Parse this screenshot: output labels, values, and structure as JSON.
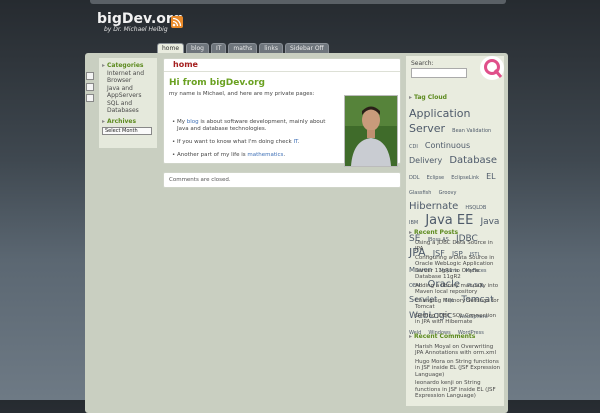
{
  "site": {
    "title": "bigDev.org",
    "subtitle": "by Dr. Michael Helbig"
  },
  "nav": {
    "tabs": [
      "home",
      "blog",
      "IT",
      "maths",
      "links",
      "Sidebar Off"
    ],
    "active_index": 0
  },
  "sidebar_left": {
    "categories_title": "Categories",
    "categories": [
      "Internet and Browser",
      "Java and AppServers",
      "SQL and Databases"
    ],
    "archives_title": "Archives",
    "archives_select": "Select Month"
  },
  "main": {
    "page_title": "home",
    "post_title": "Hi from bigDev.org",
    "intro": "my name is Michael, and here are my private pages:",
    "bullet1_pre": "My ",
    "bullet1_link": "blog",
    "bullet1_post": " is about software development, mainly about Java and database technologies.",
    "bullet2_pre": "If you want to know what I'm doing check ",
    "bullet2_link": "IT",
    "bullet2_post": ".",
    "bullet3_pre": "Another part of my life is ",
    "bullet3_link": "mathematics",
    "bullet3_post": ".",
    "comments": "Comments are closed."
  },
  "sidebar_right": {
    "search_label": "Search:",
    "tag_cloud_title": "Tag Cloud",
    "tags": [
      {
        "t": "Application Server",
        "s": 11
      },
      {
        "t": "Bean Validation",
        "s": 5
      },
      {
        "t": "CDI",
        "s": 5
      },
      {
        "t": "Continuous Delivery",
        "s": 8
      },
      {
        "t": "Database",
        "s": 10
      },
      {
        "t": "DDL",
        "s": 5
      },
      {
        "t": "Eclipse",
        "s": 5
      },
      {
        "t": "EclipseLink",
        "s": 5
      },
      {
        "t": "EL",
        "s": 8
      },
      {
        "t": "Glassfish",
        "s": 5
      },
      {
        "t": "Groovy",
        "s": 5
      },
      {
        "t": "Hibernate",
        "s": 10
      },
      {
        "t": "HSQLDB",
        "s": 5
      },
      {
        "t": "IBM",
        "s": 5
      },
      {
        "t": "Java EE",
        "s": 13
      },
      {
        "t": "Java SE",
        "s": 9
      },
      {
        "t": "JBoss AS",
        "s": 5
      },
      {
        "t": "JDBC",
        "s": 9
      },
      {
        "t": "JPA",
        "s": 11
      },
      {
        "t": "JSF",
        "s": 8
      },
      {
        "t": "JSP",
        "s": 7
      },
      {
        "t": "JSTL",
        "s": 5
      },
      {
        "t": "Maven",
        "s": 7
      },
      {
        "t": "Mojarra",
        "s": 5
      },
      {
        "t": "MyFaces",
        "s": 5
      },
      {
        "t": "OEM",
        "s": 5
      },
      {
        "t": "Oracle",
        "s": 10
      },
      {
        "t": "PL/SQL",
        "s": 5
      },
      {
        "t": "Servlet",
        "s": 8
      },
      {
        "t": "SQL",
        "s": 5
      },
      {
        "t": "Tomcat",
        "s": 9
      },
      {
        "t": "WebLogic",
        "s": 9
      },
      {
        "t": "WebSphere",
        "s": 5
      },
      {
        "t": "Weld",
        "s": 5
      },
      {
        "t": "Windows",
        "s": 5
      },
      {
        "t": "WordPress",
        "s": 5
      }
    ],
    "recent_posts_title": "Recent Posts",
    "recent_posts": [
      "Using a JDBC Data Source in JPA",
      "Configuring a Data Source in Oracle WebLogic Application Server 11gR1 to Oracle Database 11gR2",
      "Adding a library manually into Maven local repository",
      "Changing Memory Settings for Tomcat",
      "Getting JDBC SQL Connection in JPA with Hibernate"
    ],
    "recent_comments_title": "Recent Comments",
    "recent_comments": [
      "Harish Moyal on Overwriting JPA Annotations with orm.xml",
      "Hugo Mora on String functions in JSF inside EL (JSF Expression Language)",
      "leonardo kenji on String functions in JSF inside EL (JSF Expression Language)"
    ]
  },
  "colors": {
    "accent_green": "#6aa121",
    "header_red": "#a52020",
    "rss_orange": "#e98a2a"
  },
  "icons": [
    "rss-icon",
    "search-logo-icon",
    "print-icon",
    "mail-icon",
    "bookmark-icon"
  ]
}
